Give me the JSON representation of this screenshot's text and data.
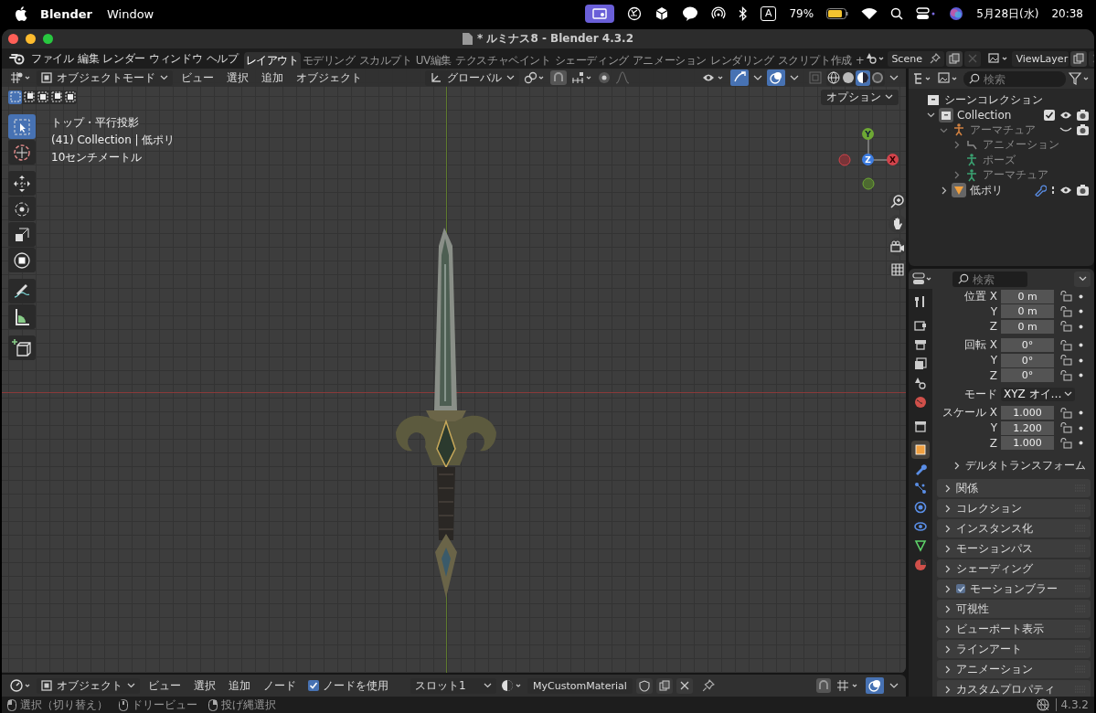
{
  "menubar": {
    "app": "Blender",
    "menus": [
      "Window"
    ],
    "input_mode": "A",
    "battery": "79%",
    "date": "5月28日(水)",
    "time": "20:38"
  },
  "window": {
    "title": "* ルミナス8 - Blender 4.3.2"
  },
  "topbar": {
    "menus": [
      "ファイル",
      "編集",
      "レンダー",
      "ウィンドウ",
      "ヘルプ"
    ],
    "workspaces": [
      {
        "label": "レイアウト",
        "selected": true
      },
      {
        "label": "モデリング",
        "selected": false
      },
      {
        "label": "スカルプト",
        "selected": false
      },
      {
        "label": "UV編集",
        "selected": false
      },
      {
        "label": "テクスチャペイント",
        "selected": false
      },
      {
        "label": "シェーディング",
        "selected": false
      },
      {
        "label": "アニメーション",
        "selected": false
      },
      {
        "label": "レンダリング",
        "selected": false
      },
      {
        "label": "スクリプト作成",
        "selected": false
      }
    ],
    "add_workspace": "+",
    "scene": "Scene",
    "view_layer": "ViewLayer"
  },
  "viewport": {
    "mode": "オブジェクトモード",
    "menus": [
      "ビュー",
      "選択",
      "追加",
      "オブジェクト"
    ],
    "orientation": "グローバル",
    "options": "オプション",
    "select_modes": [
      {
        "selected": true
      },
      {
        "selected": false
      },
      {
        "selected": false
      },
      {
        "selected": false
      },
      {
        "selected": false
      }
    ],
    "shading": [
      {
        "kind": "wireframe",
        "selected": false
      },
      {
        "kind": "solid",
        "selected": false
      },
      {
        "kind": "material",
        "selected": true
      },
      {
        "kind": "rendered",
        "selected": false
      }
    ],
    "overlay_text": [
      "トップ・平行投影",
      "(41) Collection | 低ポリ",
      "10センチメートル"
    ],
    "tools": [
      {
        "kind": "select",
        "selected": true
      },
      {
        "kind": "cursor",
        "selected": false
      },
      {
        "kind": "move",
        "selected": false
      },
      {
        "kind": "rotate",
        "selected": false
      },
      {
        "kind": "scale",
        "selected": false
      },
      {
        "kind": "transform",
        "selected": false
      },
      {
        "kind": "annotate",
        "selected": false
      },
      {
        "kind": "measure",
        "selected": false
      },
      {
        "kind": "add_cube",
        "selected": false
      }
    ],
    "gizmo": {
      "y": "Y",
      "x": "X",
      "z": "Z"
    }
  },
  "outliner": {
    "search_placeholder": "検索",
    "tree": [
      {
        "label": "シーンコレクション",
        "kind": "scene",
        "dimmed": false,
        "children": [
          {
            "label": "Collection",
            "kind": "collection",
            "dimmed": false,
            "expanded": true,
            "checked": true,
            "children": [
              {
                "label": "アーマチュア",
                "kind": "armature",
                "dimmed": true,
                "expanded": true,
                "children": [
                  {
                    "label": "アニメーション",
                    "kind": "animation",
                    "dimmed": true,
                    "expanded": false
                  },
                  {
                    "label": "ポーズ",
                    "kind": "pose",
                    "dimmed": true
                  },
                  {
                    "label": "アーマチュア",
                    "kind": "armature_data",
                    "dimmed": true,
                    "expanded": false
                  }
                ]
              },
              {
                "label": "低ポリ",
                "kind": "mesh",
                "dimmed": false,
                "expanded": false
              }
            ]
          }
        ]
      }
    ]
  },
  "properties": {
    "search_placeholder": "検索",
    "tabs": [
      {
        "kind": "tool",
        "selected": false
      },
      {
        "kind": "render",
        "selected": false
      },
      {
        "kind": "output",
        "selected": false
      },
      {
        "kind": "view_layer",
        "selected": false
      },
      {
        "kind": "scene",
        "selected": false
      },
      {
        "kind": "world",
        "selected": false
      },
      {
        "kind": "collection",
        "selected": false
      },
      {
        "kind": "object",
        "selected": true
      },
      {
        "kind": "modifiers",
        "selected": false
      },
      {
        "kind": "particles",
        "selected": false
      },
      {
        "kind": "physics",
        "selected": false
      },
      {
        "kind": "constraints",
        "selected": false
      },
      {
        "kind": "data",
        "selected": false
      },
      {
        "kind": "material",
        "selected": false
      }
    ],
    "transform": [
      {
        "label": "位置 X",
        "value": "0 m"
      },
      {
        "label": "Y",
        "value": "0 m"
      },
      {
        "label": "Z",
        "value": "0 m"
      },
      {
        "label": "回転 X",
        "value": "0°"
      },
      {
        "label": "Y",
        "value": "0°"
      },
      {
        "label": "Z",
        "value": "0°"
      },
      {
        "label": "モード",
        "value": "XYZ オイ…",
        "kind": "dropdown"
      },
      {
        "label": "スケール X",
        "value": "1.000"
      },
      {
        "label": "Y",
        "value": "1.200"
      },
      {
        "label": "Z",
        "value": "1.000"
      }
    ],
    "subpanel": "デルタトランスフォーム",
    "panels": [
      {
        "label": "関係"
      },
      {
        "label": "コレクション"
      },
      {
        "label": "インスタンス化"
      },
      {
        "label": "モーションパス"
      },
      {
        "label": "シェーディング"
      },
      {
        "label": "モーションブラー",
        "checked": true
      },
      {
        "label": "可視性"
      },
      {
        "label": "ビューポート表示"
      },
      {
        "label": "ラインアート"
      },
      {
        "label": "アニメーション"
      },
      {
        "label": "カスタムプロパティ"
      }
    ]
  },
  "shader_header": {
    "mode": "オブジェクト",
    "menus": [
      "ビュー",
      "選択",
      "追加",
      "ノード"
    ],
    "use_nodes": {
      "label": "ノードを使用",
      "checked": true
    },
    "slot": "スロット1",
    "material": "MyCustomMaterial"
  },
  "status_bar": {
    "hints": [
      "選択（切り替え）",
      "ドリービュー",
      "投げ縄選択"
    ],
    "version": "4.3.2"
  }
}
